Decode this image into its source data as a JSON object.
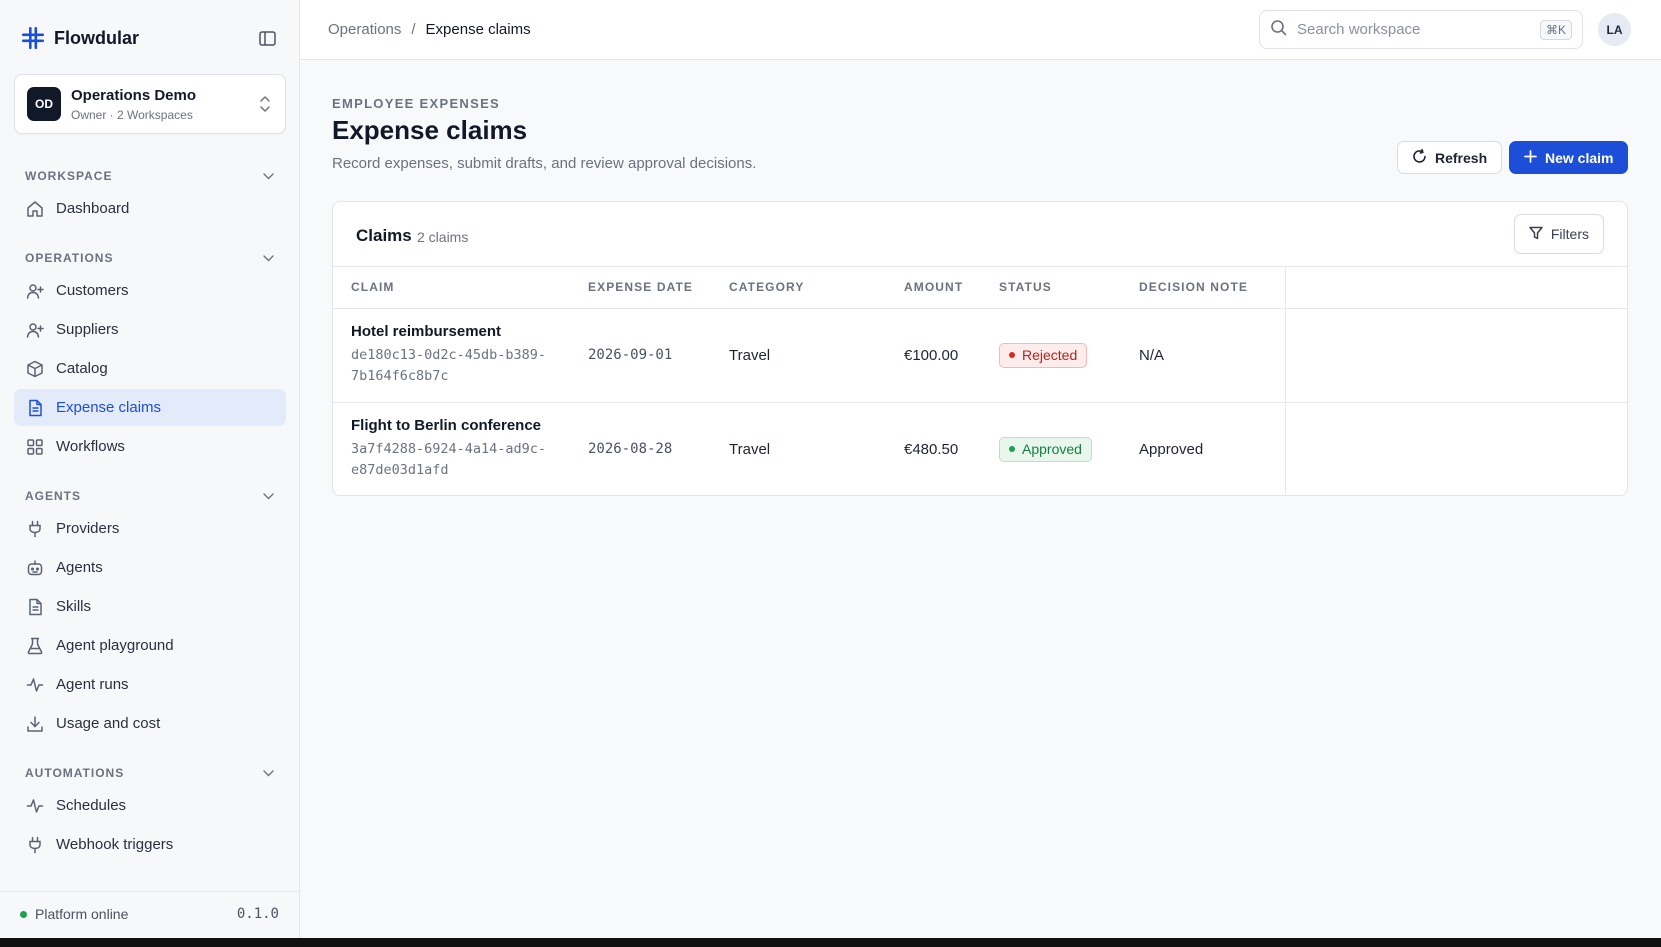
{
  "brand": {
    "name": "Flowdular"
  },
  "workspace": {
    "initials": "OD",
    "name": "Operations Demo",
    "meta": "Owner · 2 Workspaces"
  },
  "sidebar": {
    "sections": [
      {
        "label": "WORKSPACE",
        "items": [
          {
            "label": "Dashboard",
            "icon": "home-icon"
          }
        ]
      },
      {
        "label": "OPERATIONS",
        "items": [
          {
            "label": "Customers",
            "icon": "user-plus-icon"
          },
          {
            "label": "Suppliers",
            "icon": "user-plus-icon"
          },
          {
            "label": "Catalog",
            "icon": "box-icon"
          },
          {
            "label": "Expense claims",
            "icon": "document-icon",
            "active": true
          },
          {
            "label": "Workflows",
            "icon": "grid-icon"
          }
        ]
      },
      {
        "label": "AGENTS",
        "items": [
          {
            "label": "Providers",
            "icon": "plug-icon"
          },
          {
            "label": "Agents",
            "icon": "bot-icon"
          },
          {
            "label": "Skills",
            "icon": "document-icon"
          },
          {
            "label": "Agent playground",
            "icon": "flask-icon"
          },
          {
            "label": "Agent runs",
            "icon": "activity-icon"
          },
          {
            "label": "Usage and cost",
            "icon": "download-icon"
          }
        ]
      },
      {
        "label": "AUTOMATIONS",
        "items": [
          {
            "label": "Schedules",
            "icon": "activity-icon"
          },
          {
            "label": "Webhook triggers",
            "icon": "plug-icon"
          }
        ]
      }
    ],
    "footer": {
      "status": "Platform online",
      "version": "0.1.0"
    }
  },
  "topbar": {
    "breadcrumb": {
      "parent": "Operations",
      "separator": "/",
      "current": "Expense claims"
    },
    "search": {
      "placeholder": "Search workspace",
      "shortcut": "⌘K"
    },
    "user_initials": "LA"
  },
  "page": {
    "eyebrow": "EMPLOYEE EXPENSES",
    "title": "Expense claims",
    "subtitle": "Record expenses, submit drafts, and review approval decisions.",
    "refresh_label": "Refresh",
    "new_label": "New claim"
  },
  "claims": {
    "title": "Claims",
    "count": "2 claims",
    "filters_label": "Filters",
    "columns": [
      "CLAIM",
      "EXPENSE DATE",
      "CATEGORY",
      "AMOUNT",
      "STATUS",
      "DECISION NOTE"
    ],
    "rows": [
      {
        "title": "Hotel reimbursement",
        "id_line1": "de180c13-0d2c-45db-b389-",
        "id_line2": "7b164f6c8b7c",
        "date": "2026-09-01",
        "category": "Travel",
        "amount": "€100.00",
        "status": "Rejected",
        "status_kind": "rejected",
        "note": "N/A"
      },
      {
        "title": "Flight to Berlin conference",
        "id_line1": "3a7f4288-6924-4a14-ad9c-",
        "id_line2": "e87de03d1afd",
        "date": "2026-08-28",
        "category": "Travel",
        "amount": "€480.50",
        "status": "Approved",
        "status_kind": "approved",
        "note": "Approved"
      }
    ]
  },
  "colors": {
    "accent": "#1d4ed8",
    "active_bg": "#e3ebfb",
    "success": "#16a34a",
    "danger": "#dc2626"
  }
}
